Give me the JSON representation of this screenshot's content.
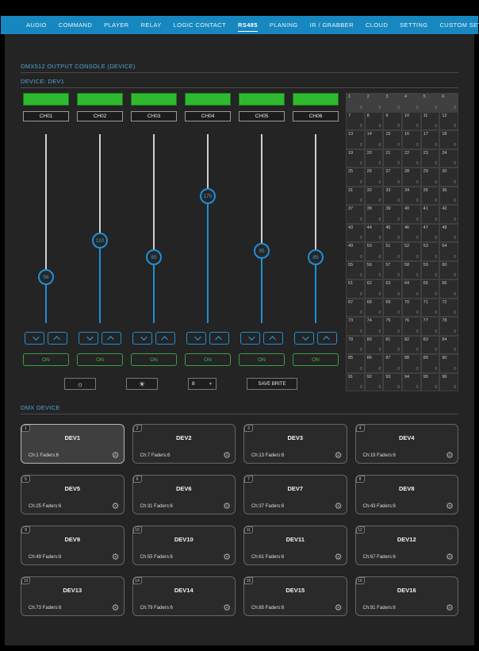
{
  "nav": {
    "items": [
      {
        "label": "AUDIO",
        "active": false
      },
      {
        "label": "COMMAND",
        "active": false
      },
      {
        "label": "PLAYER",
        "active": false
      },
      {
        "label": "RELAY",
        "active": false
      },
      {
        "label": "LOGIC CONTACT",
        "active": false
      },
      {
        "label": "RS485",
        "active": true
      },
      {
        "label": "PLANING",
        "active": false
      },
      {
        "label": "IR / GRABBER",
        "active": false
      },
      {
        "label": "CLOUD",
        "active": false
      },
      {
        "label": "SETTING",
        "active": false
      },
      {
        "label": "CUSTOM SETTINGS",
        "active": false
      }
    ]
  },
  "console": {
    "title": "DMX512 OUTPUT CONSOLE (DEVICE)",
    "device_label": "DEVICE: DEV1",
    "slider_max": 255,
    "channels": [
      {
        "label": "CH01",
        "value": 56,
        "on_label": "ON"
      },
      {
        "label": "CH02",
        "value": 110,
        "on_label": "ON"
      },
      {
        "label": "CH03",
        "value": 85,
        "on_label": "ON"
      },
      {
        "label": "CH04",
        "value": 175,
        "on_label": "ON"
      },
      {
        "label": "CH05",
        "value": 95,
        "on_label": "ON"
      },
      {
        "label": "CH06",
        "value": 85,
        "on_label": "ON"
      }
    ],
    "controls": {
      "dim_icon": "☼",
      "bright_icon": "☀",
      "fade_value": "8",
      "save_label": "SAVE BRITE"
    },
    "channel_grid": {
      "count": 96,
      "start": 1,
      "cell_value": "0",
      "highlighted_count": 6,
      "columns": 6
    }
  },
  "devices": {
    "title": "DMX DEVICE",
    "gear_icon": "⚙",
    "cards": [
      {
        "num": "1",
        "name": "DEV1",
        "info": "Ch:1 Faders:6",
        "selected": true
      },
      {
        "num": "2",
        "name": "DEV2",
        "info": "Ch:7 Faders:6",
        "selected": false
      },
      {
        "num": "3",
        "name": "DEV3",
        "info": "Ch:13 Faders:6",
        "selected": false
      },
      {
        "num": "4",
        "name": "DEV4",
        "info": "Ch:19 Faders:6",
        "selected": false
      },
      {
        "num": "5",
        "name": "DEV5",
        "info": "Ch:25 Faders:6",
        "selected": false
      },
      {
        "num": "6",
        "name": "DEV6",
        "info": "Ch:31 Faders:6",
        "selected": false
      },
      {
        "num": "7",
        "name": "DEV7",
        "info": "Ch:37 Faders:6",
        "selected": false
      },
      {
        "num": "8",
        "name": "DEV8",
        "info": "Ch:43 Faders:6",
        "selected": false
      },
      {
        "num": "9",
        "name": "DEV9",
        "info": "Ch:49 Faders:6",
        "selected": false
      },
      {
        "num": "10",
        "name": "DEV10",
        "info": "Ch:55 Faders:6",
        "selected": false
      },
      {
        "num": "11",
        "name": "DEV11",
        "info": "Ch:61 Faders:6",
        "selected": false
      },
      {
        "num": "12",
        "name": "DEV12",
        "info": "Ch:67 Faders:6",
        "selected": false
      },
      {
        "num": "13",
        "name": "DEV13",
        "info": "Ch:73 Faders:6",
        "selected": false
      },
      {
        "num": "14",
        "name": "DEV14",
        "info": "Ch:79 Faders:6",
        "selected": false
      },
      {
        "num": "15",
        "name": "DEV15",
        "info": "Ch:85 Faders:6",
        "selected": false
      },
      {
        "num": "16",
        "name": "DEV16",
        "info": "Ch:91 Faders:6",
        "selected": false
      }
    ]
  },
  "colors": {
    "nav_blue": "#1787c0",
    "accent_blue": "#1f8fd5",
    "title_blue": "#4fa3d1",
    "level_green": "#2fb92f",
    "on_green": "#3a9e4a"
  }
}
